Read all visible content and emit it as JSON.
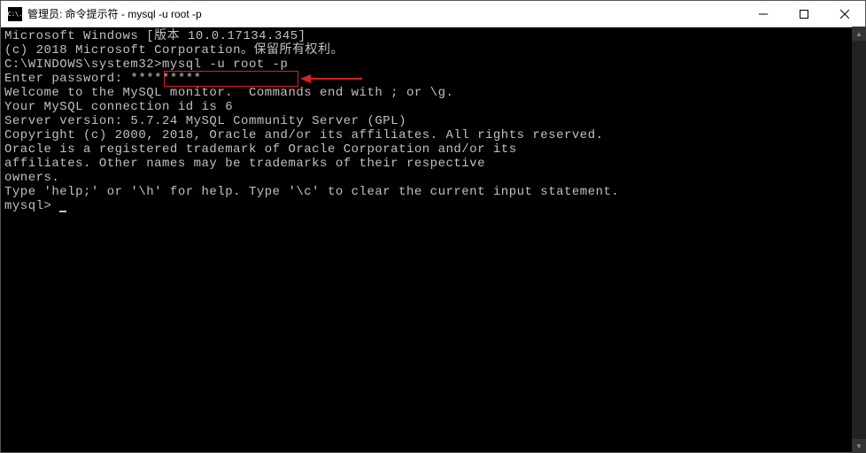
{
  "window": {
    "title": "管理员: 命令提示符 - mysql  -u root -p",
    "icon_text": "C:\\."
  },
  "terminal": {
    "lines": [
      "Microsoft Windows [版本 10.0.17134.345]",
      "(c) 2018 Microsoft Corporation。保留所有权利。",
      "",
      "C:\\WINDOWS\\system32>mysql -u root -p",
      "Enter password: *********",
      "Welcome to the MySQL monitor.  Commands end with ; or \\g.",
      "Your MySQL connection id is 6",
      "Server version: 5.7.24 MySQL Community Server (GPL)",
      "",
      "Copyright (c) 2000, 2018, Oracle and/or its affiliates. All rights reserved.",
      "",
      "Oracle is a registered trademark of Oracle Corporation and/or its",
      "affiliates. Other names may be trademarks of their respective",
      "owners.",
      "",
      "Type 'help;' or '\\h' for help. Type '\\c' to clear the current input statement.",
      "",
      "mysql> "
    ],
    "highlighted_command": "mysql -u root -p",
    "prompt_path": "C:\\WINDOWS\\system32>",
    "current_prompt": "mysql>"
  }
}
